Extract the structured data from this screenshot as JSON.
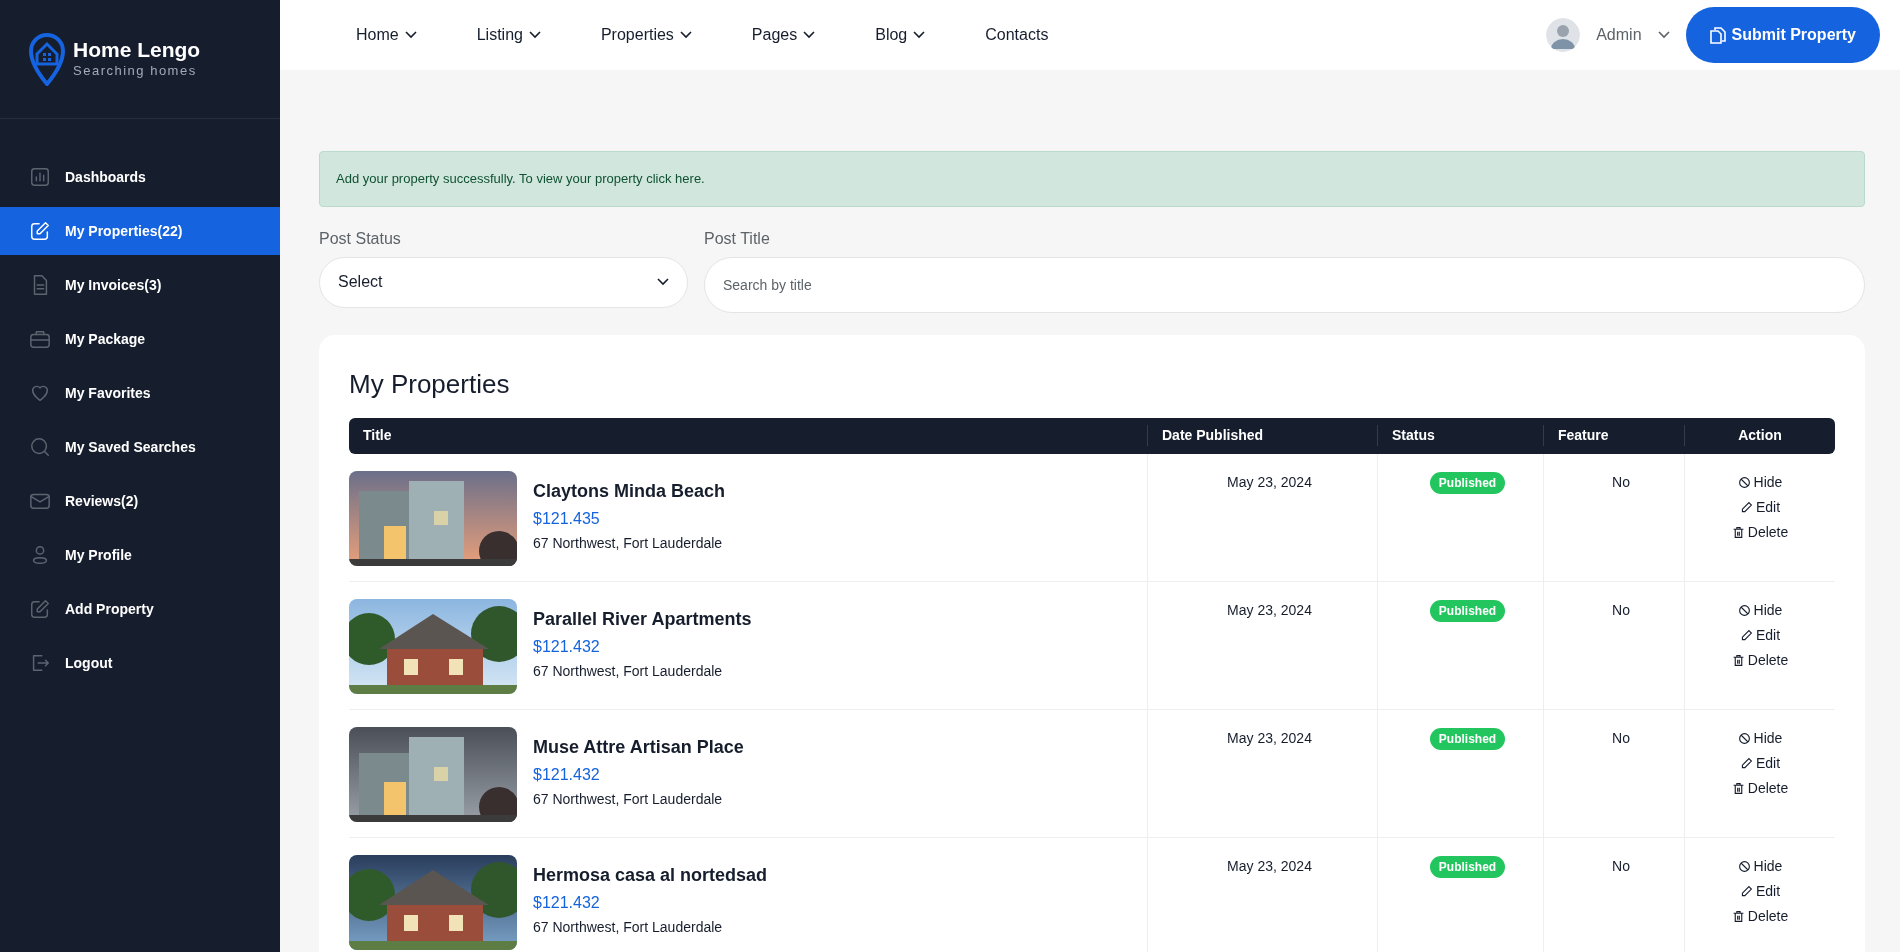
{
  "brand": {
    "name": "Home Lengo",
    "tagline": "Searching homes"
  },
  "sidebar": {
    "items": [
      {
        "kind": "chart",
        "label": "Dashboards",
        "selected": false
      },
      {
        "kind": "edit",
        "label": "My Properties(22)",
        "selected": true
      },
      {
        "kind": "file",
        "label": "My Invoices(3)",
        "selected": false
      },
      {
        "kind": "briefcase",
        "label": "My Package",
        "selected": false
      },
      {
        "kind": "heart",
        "label": "My Favorites",
        "selected": false
      },
      {
        "kind": "search",
        "label": "My Saved Searches",
        "selected": false
      },
      {
        "kind": "mail",
        "label": "Reviews(2)",
        "selected": false
      },
      {
        "kind": "user",
        "label": "My Profile",
        "selected": false
      },
      {
        "kind": "edit",
        "label": "Add Property",
        "selected": false
      },
      {
        "kind": "logout",
        "label": "Logout",
        "selected": false
      }
    ]
  },
  "nav": [
    {
      "label": "Home",
      "has_menu": true
    },
    {
      "label": "Listing",
      "has_menu": true
    },
    {
      "label": "Properties",
      "has_menu": true
    },
    {
      "label": "Pages",
      "has_menu": true
    },
    {
      "label": "Blog",
      "has_menu": true
    },
    {
      "label": "Contacts",
      "has_menu": false
    }
  ],
  "user": {
    "name": "Admin"
  },
  "submit_button": "Submit Property",
  "alert": "Add your property successfully. To view your property click here.",
  "filters": {
    "status": {
      "label": "Post Status",
      "value": "Select"
    },
    "title": {
      "label": "Post Title",
      "placeholder": "Search by title"
    }
  },
  "table": {
    "title": "My Properties",
    "columns": [
      "Title",
      "Date Published",
      "Status",
      "Feature",
      "Action"
    ],
    "rows": [
      {
        "name": "Claytons Minda Beach",
        "price": "$121.435",
        "address": "67 Northwest, Fort Lauderdale",
        "date": "May 23, 2024",
        "status": "Published",
        "feature": "No",
        "actions": [
          {
            "kind": "hide",
            "label": "Hide"
          },
          {
            "kind": "edit",
            "label": "Edit"
          },
          {
            "kind": "delete",
            "label": "Delete"
          }
        ]
      },
      {
        "name": "Parallel River Apartments",
        "price": "$121.432",
        "address": "67 Northwest, Fort Lauderdale",
        "date": "May 23, 2024",
        "status": "Published",
        "feature": "No",
        "actions": [
          {
            "kind": "hide",
            "label": "Hide"
          },
          {
            "kind": "edit",
            "label": "Edit"
          },
          {
            "kind": "delete",
            "label": "Delete"
          }
        ]
      },
      {
        "name": "Muse Attre Artisan Place",
        "price": "$121.432",
        "address": "67 Northwest, Fort Lauderdale",
        "date": "May 23, 2024",
        "status": "Published",
        "feature": "No",
        "actions": [
          {
            "kind": "hide",
            "label": "Hide"
          },
          {
            "kind": "edit",
            "label": "Edit"
          },
          {
            "kind": "delete",
            "label": "Delete"
          }
        ]
      },
      {
        "name": "Hermosa casa al nortedsad",
        "price": "$121.432",
        "address": "67 Northwest, Fort Lauderdale",
        "date": "May 23, 2024",
        "status": "Published",
        "feature": "No",
        "actions": [
          {
            "kind": "hide",
            "label": "Hide"
          },
          {
            "kind": "edit",
            "label": "Edit"
          },
          {
            "kind": "delete",
            "label": "Delete"
          }
        ]
      }
    ]
  }
}
